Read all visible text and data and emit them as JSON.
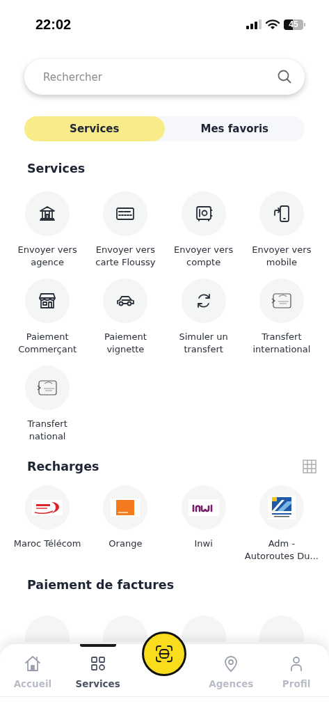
{
  "status_bar": {
    "time": "22:02",
    "battery": "45"
  },
  "search": {
    "placeholder": "Rechercher"
  },
  "tabs": [
    {
      "label": "Services",
      "selected": true
    },
    {
      "label": "Mes favoris",
      "selected": false
    }
  ],
  "services": {
    "title": "Services",
    "items": [
      {
        "label": "Envoyer vers agence"
      },
      {
        "label": "Envoyer vers carte Floussy"
      },
      {
        "label": "Envoyer vers compte"
      },
      {
        "label": "Envoyer vers mobile"
      },
      {
        "label": "Paiement Commerçant"
      },
      {
        "label": "Paiement vignette"
      },
      {
        "label": "Simuler un transfert"
      },
      {
        "label": "Transfert international"
      },
      {
        "label": "Transfert national"
      }
    ]
  },
  "recharges": {
    "title": "Recharges",
    "items": [
      {
        "label": "Maroc Télécom"
      },
      {
        "label": "Orange"
      },
      {
        "label": "Inwi"
      },
      {
        "label": "Adm - Autoroutes Du..."
      }
    ]
  },
  "bills": {
    "title": "Paiement de factures"
  },
  "nav": [
    {
      "label": "Accueil",
      "selected": false
    },
    {
      "label": "Services",
      "selected": true
    },
    {
      "label": "Agences",
      "selected": false
    },
    {
      "label": "Profil",
      "selected": false
    }
  ]
}
